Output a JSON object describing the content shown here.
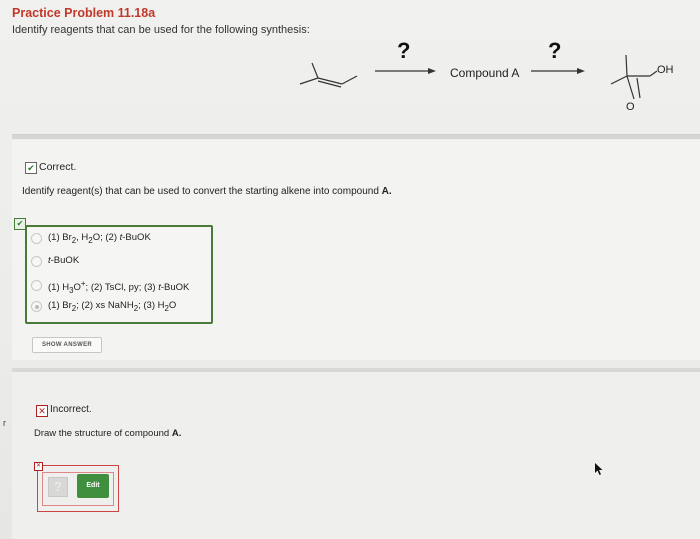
{
  "header": {
    "title": "Practice Problem 11.18a",
    "subtitle": "Identify reagents that can be used for the following synthesis:"
  },
  "scheme": {
    "arrow1_label": "?",
    "arrow2_label": "?",
    "intermediate_label": "Compound A",
    "oh_label": "OH",
    "o_label": "O"
  },
  "part1": {
    "status": "Correct.",
    "instruction_prefix": "Identify reagent(s) that can be used to convert the starting alkene into compound ",
    "instruction_bold": "A.",
    "options": [
      {
        "html": "(1) Br<sub>2</sub>, H<sub>2</sub>O; (2) <i>t</i>-BuOK",
        "selected": false
      },
      {
        "html": "<i>t</i>-BuOK",
        "selected": false
      },
      {
        "html": "(1) H<sub>3</sub>O<sup>+</sup>; (2) TsCl, py; (3) <i>t</i>-BuOK",
        "selected": false
      },
      {
        "html": "(1) Br<sub>2</sub>; (2) xs NaNH<sub>2</sub>; (3) H<sub>2</sub>O",
        "selected": true
      }
    ],
    "show_answer_label": "SHOW ANSWER"
  },
  "part2": {
    "status": "Incorrect.",
    "instruction_prefix": "Draw the structure of compound ",
    "instruction_bold": "A.",
    "help_label": "?",
    "edit_label": "Edit"
  },
  "edge_mark": "r",
  "colors": {
    "title": "#c0392b",
    "correct": "#2a7a2a",
    "incorrect": "#b02020",
    "edit_button": "#3f8f3f"
  }
}
